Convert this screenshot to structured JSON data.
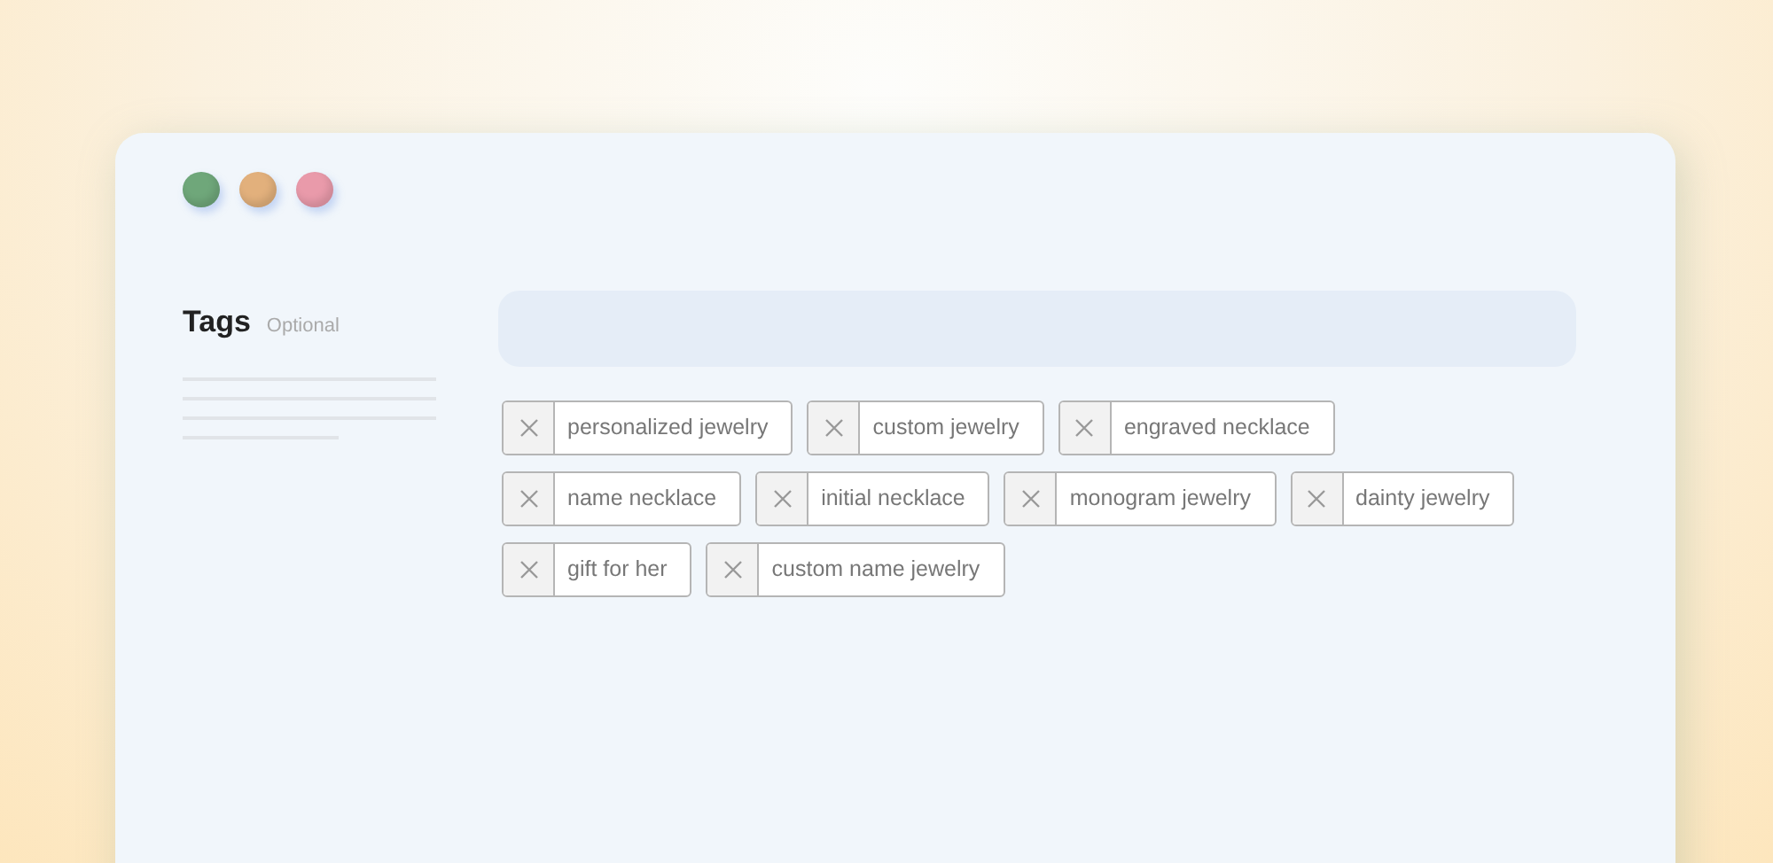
{
  "window": {
    "controls": [
      {
        "color": "#6fa77a"
      },
      {
        "color": "#e2b07c"
      },
      {
        "color": "#e99aaa"
      }
    ]
  },
  "field": {
    "label": "Tags",
    "hint": "Optional"
  },
  "tags": [
    {
      "label": "personalized jewelry"
    },
    {
      "label": "custom jewelry"
    },
    {
      "label": "engraved necklace"
    },
    {
      "label": "name necklace"
    },
    {
      "label": "initial necklace"
    },
    {
      "label": "monogram jewelry"
    },
    {
      "label": "dainty jewelry"
    },
    {
      "label": "gift for her"
    },
    {
      "label": "custom name jewelry"
    }
  ]
}
